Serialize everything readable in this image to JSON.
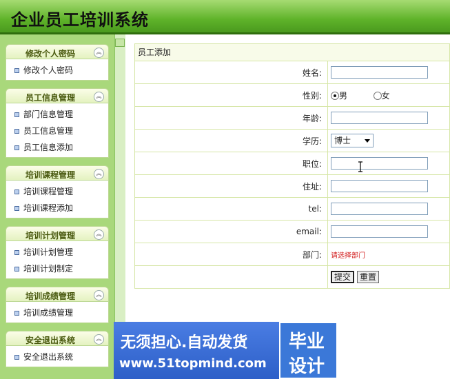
{
  "app": {
    "title": "企业员工培训系统"
  },
  "sidebar": {
    "groups": [
      {
        "title": "修改个人密码",
        "items": [
          {
            "label": "修改个人密码"
          }
        ]
      },
      {
        "title": "员工信息管理",
        "items": [
          {
            "label": "部门信息管理"
          },
          {
            "label": "员工信息管理"
          },
          {
            "label": "员工信息添加"
          }
        ]
      },
      {
        "title": "培训课程管理",
        "items": [
          {
            "label": "培训课程管理"
          },
          {
            "label": "培训课程添加"
          }
        ]
      },
      {
        "title": "培训计划管理",
        "items": [
          {
            "label": "培训计划管理"
          },
          {
            "label": "培训计划制定"
          }
        ]
      },
      {
        "title": "培训成绩管理",
        "items": [
          {
            "label": "培训成绩管理"
          }
        ]
      },
      {
        "title": "安全退出系统",
        "items": [
          {
            "label": "安全退出系统"
          }
        ]
      }
    ],
    "toggle_icon": "collapse-up-icon"
  },
  "form": {
    "title": "员工添加",
    "fields": {
      "name": {
        "label": "姓名:",
        "value": ""
      },
      "gender": {
        "label": "性别:",
        "options": [
          "男",
          "女"
        ],
        "selected": "男"
      },
      "age": {
        "label": "年龄:",
        "value": ""
      },
      "education": {
        "label": "学历:",
        "value": "博士"
      },
      "position": {
        "label": "职位:",
        "value": ""
      },
      "address": {
        "label": "住址:",
        "value": ""
      },
      "tel": {
        "label": "tel:",
        "value": ""
      },
      "email": {
        "label": "email:",
        "value": ""
      },
      "department": {
        "label": "部门:",
        "message": "请选择部门"
      }
    },
    "buttons": {
      "submit": "提交",
      "reset": "重置"
    }
  },
  "banner": {
    "line1": "无须担心.自动发货",
    "line2": "www.51topmind.com",
    "box_line1": "毕业",
    "box_line2": "设计"
  },
  "colors": {
    "header": "#5fb32a",
    "sidebar": "#a9d87b",
    "error": "#d32020"
  }
}
